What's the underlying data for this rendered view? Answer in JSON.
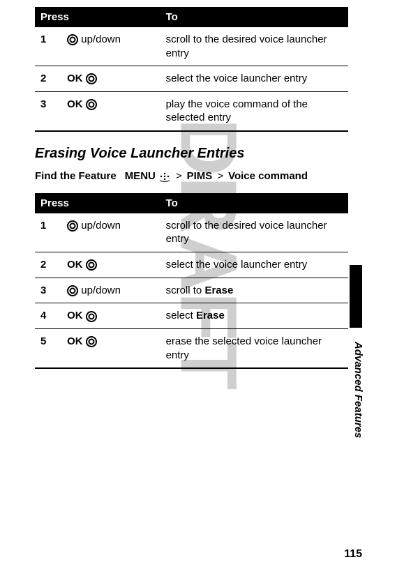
{
  "watermark": "DRAFT",
  "table1": {
    "header_press": "Press",
    "header_to": "To",
    "rows": [
      {
        "num": "1",
        "press_text": "up/down",
        "press_type": "circle",
        "to": "scroll to the desired voice launcher entry"
      },
      {
        "num": "2",
        "press_text": "OK",
        "press_type": "ok",
        "to": "select the voice launcher entry"
      },
      {
        "num": "3",
        "press_text": "OK",
        "press_type": "ok",
        "to": "play the voice command of the selected entry"
      }
    ]
  },
  "section_title": "Erasing Voice Launcher Entries",
  "find_feature": {
    "label": "Find the Feature",
    "menu": "MENU",
    "pims": "PIMS",
    "voice_command": "Voice command",
    "sep": ">"
  },
  "table2": {
    "header_press": "Press",
    "header_to": "To",
    "rows": [
      {
        "num": "1",
        "press_text": "up/down",
        "press_type": "circle",
        "to_prefix": "scroll to the desired voice launcher entry",
        "to_bold": ""
      },
      {
        "num": "2",
        "press_text": "OK",
        "press_type": "ok",
        "to_prefix": "select the voice launcher entry",
        "to_bold": ""
      },
      {
        "num": "3",
        "press_text": "up/down",
        "press_type": "circle",
        "to_prefix": "scroll to ",
        "to_bold": "Erase"
      },
      {
        "num": "4",
        "press_text": "OK",
        "press_type": "ok",
        "to_prefix": "select ",
        "to_bold": "Erase"
      },
      {
        "num": "5",
        "press_text": "OK",
        "press_type": "ok",
        "to_prefix": "erase the selected voice launcher entry",
        "to_bold": ""
      }
    ]
  },
  "side_label": "Advanced Features",
  "page_number": "115"
}
